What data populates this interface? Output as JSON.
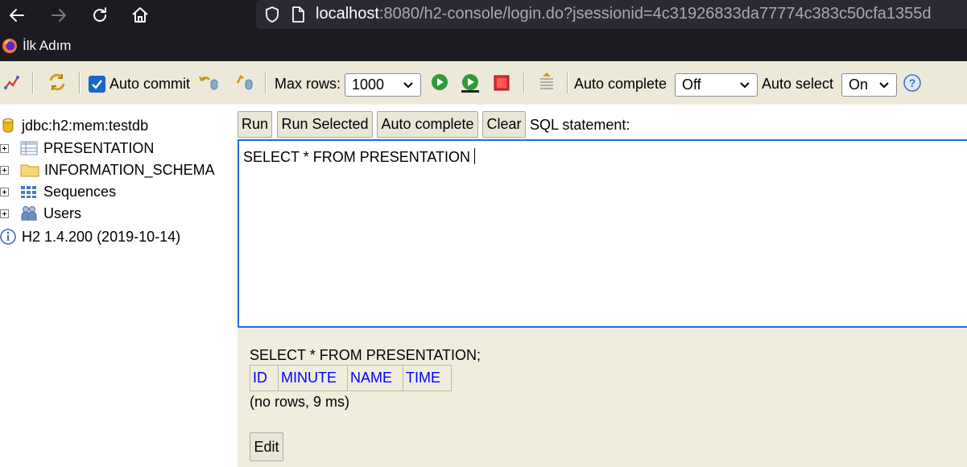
{
  "browser": {
    "url_host": "localhost",
    "url_rest": ":8080/h2-console/login.do?jsessionid=4c31926833da77774c383c50cfa1355d",
    "bookmark": "İlk Adım"
  },
  "toolbar": {
    "auto_commit_label": "Auto commit",
    "auto_commit_checked": true,
    "max_rows_label": "Max rows:",
    "max_rows_value": "1000",
    "auto_complete_label": "Auto complete",
    "auto_complete_value": "Off",
    "auto_select_label": "Auto select",
    "auto_select_value": "On"
  },
  "tree": {
    "connection": "jdbc:h2:mem:testdb",
    "items": [
      {
        "label": "PRESENTATION",
        "icon": "table-icon"
      },
      {
        "label": "INFORMATION_SCHEMA",
        "icon": "folder-icon"
      },
      {
        "label": "Sequences",
        "icon": "sequences-icon"
      },
      {
        "label": "Users",
        "icon": "users-icon"
      }
    ],
    "version": "H2 1.4.200 (2019-10-14)"
  },
  "query": {
    "run_label": "Run",
    "run_selected_label": "Run Selected",
    "auto_complete_label": "Auto complete",
    "clear_label": "Clear",
    "sql_statement_label": "SQL statement:",
    "sql_text": "SELECT * FROM PRESENTATION"
  },
  "result": {
    "statement": "SELECT * FROM PRESENTATION;",
    "columns": [
      "ID",
      "MINUTE",
      "NAME",
      "TIME"
    ],
    "meta": "(no rows, 9 ms)",
    "edit_label": "Edit"
  },
  "colors": {
    "panel_bg": "#ece9d8",
    "result_bg": "#f0eddf",
    "link_blue": "#0000ff",
    "focus_blue": "#1f6fd6"
  }
}
